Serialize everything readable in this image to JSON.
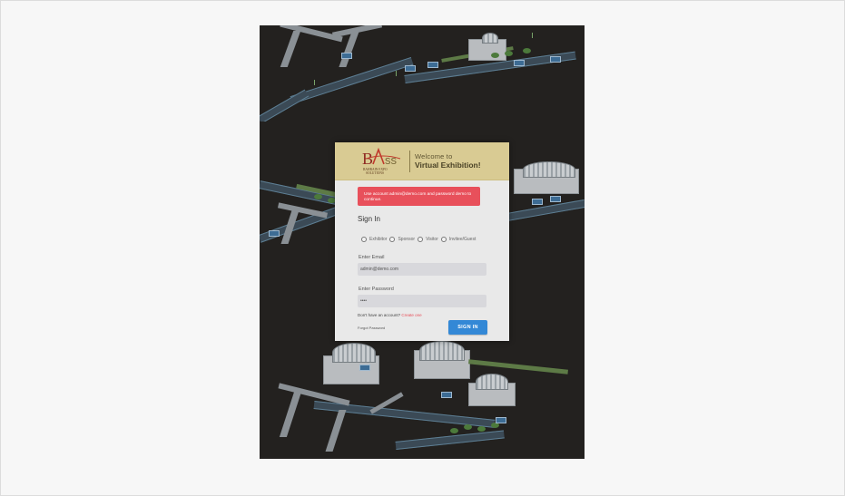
{
  "header": {
    "logo_text": "BASS",
    "logo_subtext": "BAHRAIN EXPO SOLUTIONS",
    "welcome_line1": "Welcome to",
    "welcome_line2": "Virtual Exhibition!"
  },
  "alert": {
    "message": "Use account admin@demo.com and password demo to continue."
  },
  "form": {
    "title": "Sign In",
    "roles": [
      "Exhibitor",
      "Sponsor",
      "Visitor",
      "Invitee/Guest"
    ],
    "email_label": "Enter Email",
    "email_value": "admin@demo.com",
    "password_label": "Enter Password",
    "password_value": "demo",
    "signup_text": "Don't have an account?",
    "signup_link": "Create one",
    "forgot_label": "Forgot Password",
    "signin_label": "SIGN IN"
  },
  "colors": {
    "header_bg": "#d9cb93",
    "alert_bg": "#e8505b",
    "primary_button": "#3388d6",
    "card_bg": "#e9e9e9",
    "scene_bg": "#23211f"
  }
}
